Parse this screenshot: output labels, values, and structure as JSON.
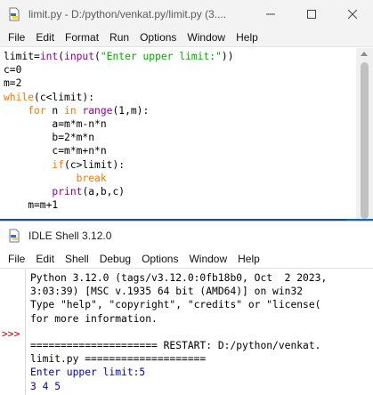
{
  "editor_window": {
    "title": "limit.py - D:/python/venkat.py/limit.py (3....",
    "menu": [
      "File",
      "Edit",
      "Format",
      "Run",
      "Options",
      "Window",
      "Help"
    ],
    "code": {
      "l1_a": "limit=",
      "l1_b": "int",
      "l1_c": "(",
      "l1_d": "input",
      "l1_e": "(",
      "l1_f": "\"Enter upper limit:\"",
      "l1_g": "))",
      "l2": "c=0",
      "l3": "m=2",
      "l4_kw": "while",
      "l4_rest": "(c<limit):",
      "l5_ind": "    ",
      "l5_for": "for",
      "l5_mid": " n ",
      "l5_in": "in",
      "l5_sp": " ",
      "l5_range": "range",
      "l5_rest": "(1,m):",
      "l6": "        a=m*m-n*n",
      "l7": "        b=2*m*n",
      "l8": "        c=m*m+n*n",
      "l9_ind": "        ",
      "l9_if": "if",
      "l9_rest": "(c>limit):",
      "l10_ind": "            ",
      "l10_break": "break",
      "l11_ind": "        ",
      "l11_print": "print",
      "l11_rest": "(a,b,c)",
      "l12": "    m=m+1"
    }
  },
  "shell_window": {
    "title": "IDLE Shell 3.12.0",
    "menu": [
      "File",
      "Edit",
      "Shell",
      "Debug",
      "Options",
      "Window",
      "Help"
    ],
    "prompt": ">>>",
    "lines": {
      "l1": "Python 3.12.0 (tags/v3.12.0:0fb18b0, Oct  2 2023,",
      "l2": "3:03:39) [MSC v.1935 64 bit (AMD64)] on win32",
      "l3": "Type \"help\", \"copyright\", \"credits\" or \"license(",
      "l4": "for more information.",
      "l5": "",
      "l6": "===================== RESTART: D:/python/venkat.",
      "l7": "limit.py ====================",
      "l8": "Enter upper limit:5",
      "l9": "3 4 5"
    }
  },
  "colors": {
    "keyword": "#ff7700",
    "builtin": "#900090",
    "string": "#00aa00",
    "output": "#0000c0",
    "prompt": "#cc0000"
  }
}
